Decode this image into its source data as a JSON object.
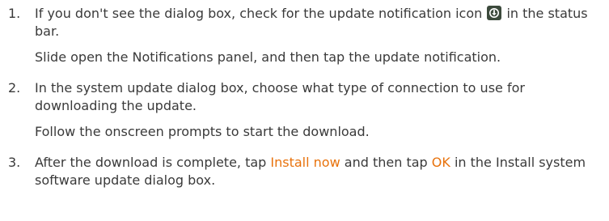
{
  "steps": [
    {
      "number": "1.",
      "text_before_icon": "If you don't see the dialog box, check for the update notification icon",
      "icon": "update-notification-icon",
      "text_after_icon": "in the status bar.",
      "sub": "Slide open the Notifications panel, and then tap the update notification."
    },
    {
      "number": "2.",
      "text": "In the system update dialog box, choose what type of connection to use for downloading the update.",
      "sub": "Follow the onscreen prompts to start the download."
    },
    {
      "number": "3.",
      "text_part1": "After the download is complete, tap",
      "term1": "Install now",
      "text_part2": "and then tap",
      "term2": "OK",
      "text_part3": "in the Install system software update dialog box."
    }
  ],
  "colors": {
    "body_text": "#3a3a3a",
    "ui_term": "#e8720c",
    "icon_bg": "#3c4a3c",
    "icon_fg": "#ffffff"
  }
}
